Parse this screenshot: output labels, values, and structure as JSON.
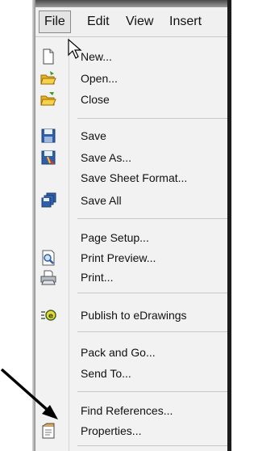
{
  "menubar": {
    "items": [
      {
        "label": "File",
        "active": true
      },
      {
        "label": "Edit"
      },
      {
        "label": "View"
      },
      {
        "label": "Insert"
      }
    ]
  },
  "file_menu": {
    "items": [
      {
        "label": "New...",
        "icon": "new-document-icon"
      },
      {
        "label": "Open...",
        "icon": "open-folder-icon"
      },
      {
        "label": "Close",
        "icon": "close-folder-icon"
      },
      {
        "label": "Save",
        "icon": "save-disk-icon"
      },
      {
        "label": "Save As...",
        "icon": "save-as-icon"
      },
      {
        "label": "Save Sheet Format...",
        "icon": ""
      },
      {
        "label": "Save All",
        "icon": "save-all-icon"
      },
      {
        "label": "Page Setup...",
        "icon": ""
      },
      {
        "label": "Print Preview...",
        "icon": "print-preview-icon"
      },
      {
        "label": "Print...",
        "icon": "printer-icon"
      },
      {
        "label": "Publish to eDrawings",
        "icon": "edrawings-icon"
      },
      {
        "label": "Pack and Go...",
        "icon": ""
      },
      {
        "label": "Send To...",
        "icon": ""
      },
      {
        "label": "Find References...",
        "icon": ""
      },
      {
        "label": "Properties...",
        "icon": "properties-icon"
      }
    ]
  },
  "colors": {
    "menu_background": "#f2f2f2",
    "separator": "#c8c8c8",
    "text": "#111111",
    "highlight_border": "#8a8a8a"
  }
}
